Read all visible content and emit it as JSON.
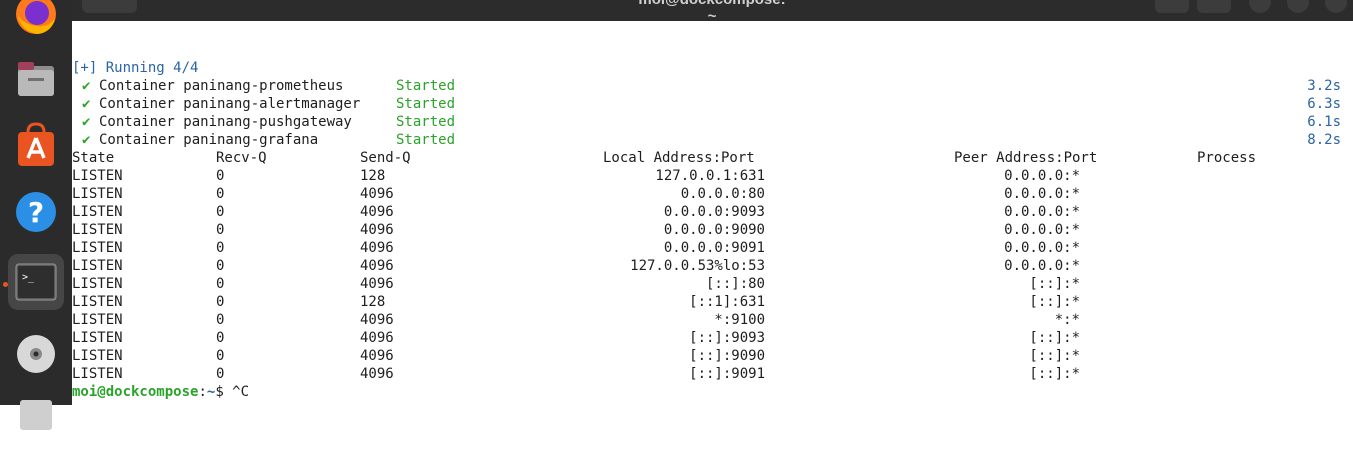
{
  "window": {
    "title": "moi@dockcompose: ~"
  },
  "dock": {
    "items": [
      {
        "name": "firefox-icon"
      },
      {
        "name": "files-icon"
      },
      {
        "name": "app-center-icon"
      },
      {
        "name": "help-icon"
      },
      {
        "name": "terminal-icon"
      },
      {
        "name": "disc-icon"
      },
      {
        "name": "drive-icon"
      }
    ]
  },
  "compose": {
    "running": "[+] Running 4/4",
    "containers": [
      {
        "check": "✔",
        "label": "Container paninang-prometheus",
        "status": "Started",
        "time": "3.2s"
      },
      {
        "check": "✔",
        "label": "Container paninang-alertmanager",
        "status": "Started",
        "time": "6.3s"
      },
      {
        "check": "✔",
        "label": "Container paninang-pushgateway",
        "status": "Started",
        "time": "6.1s"
      },
      {
        "check": "✔",
        "label": "Container paninang-grafana",
        "status": "Started",
        "time": "8.2s"
      }
    ]
  },
  "netstat": {
    "headers": {
      "state": "State",
      "recvq": "Recv-Q",
      "sendq": "Send-Q",
      "local": "Local Address:Port",
      "peer": "Peer Address:Port",
      "process": "Process"
    },
    "rows": [
      {
        "state": "LISTEN",
        "recvq": "0",
        "sendq": "128",
        "local": "127.0.0.1:631",
        "peer": "0.0.0.0:*"
      },
      {
        "state": "LISTEN",
        "recvq": "0",
        "sendq": "4096",
        "local": "0.0.0.0:80",
        "peer": "0.0.0.0:*"
      },
      {
        "state": "LISTEN",
        "recvq": "0",
        "sendq": "4096",
        "local": "0.0.0.0:9093",
        "peer": "0.0.0.0:*"
      },
      {
        "state": "LISTEN",
        "recvq": "0",
        "sendq": "4096",
        "local": "0.0.0.0:9090",
        "peer": "0.0.0.0:*"
      },
      {
        "state": "LISTEN",
        "recvq": "0",
        "sendq": "4096",
        "local": "0.0.0.0:9091",
        "peer": "0.0.0.0:*"
      },
      {
        "state": "LISTEN",
        "recvq": "0",
        "sendq": "4096",
        "local": "127.0.0.53%lo:53",
        "peer": "0.0.0.0:*"
      },
      {
        "state": "LISTEN",
        "recvq": "0",
        "sendq": "4096",
        "local": "[::]:80",
        "peer": "[::]:*"
      },
      {
        "state": "LISTEN",
        "recvq": "0",
        "sendq": "128",
        "local": "[::1]:631",
        "peer": "[::]:*"
      },
      {
        "state": "LISTEN",
        "recvq": "0",
        "sendq": "4096",
        "local": "*:9100",
        "peer": "*:*"
      },
      {
        "state": "LISTEN",
        "recvq": "0",
        "sendq": "4096",
        "local": "[::]:9093",
        "peer": "[::]:*"
      },
      {
        "state": "LISTEN",
        "recvq": "0",
        "sendq": "4096",
        "local": "[::]:9090",
        "peer": "[::]:*"
      },
      {
        "state": "LISTEN",
        "recvq": "0",
        "sendq": "4096",
        "local": "[::]:9091",
        "peer": "[::]:*"
      }
    ]
  },
  "prompt": {
    "user_host": "moi@dockcompose",
    "colon": ":",
    "path": "~",
    "dollar": "$",
    "command": " ^C"
  },
  "colors": {
    "accent": "#e95420",
    "green": "#2aa32a",
    "blue": "#2a64a6",
    "dock": "#2b2b2b"
  }
}
